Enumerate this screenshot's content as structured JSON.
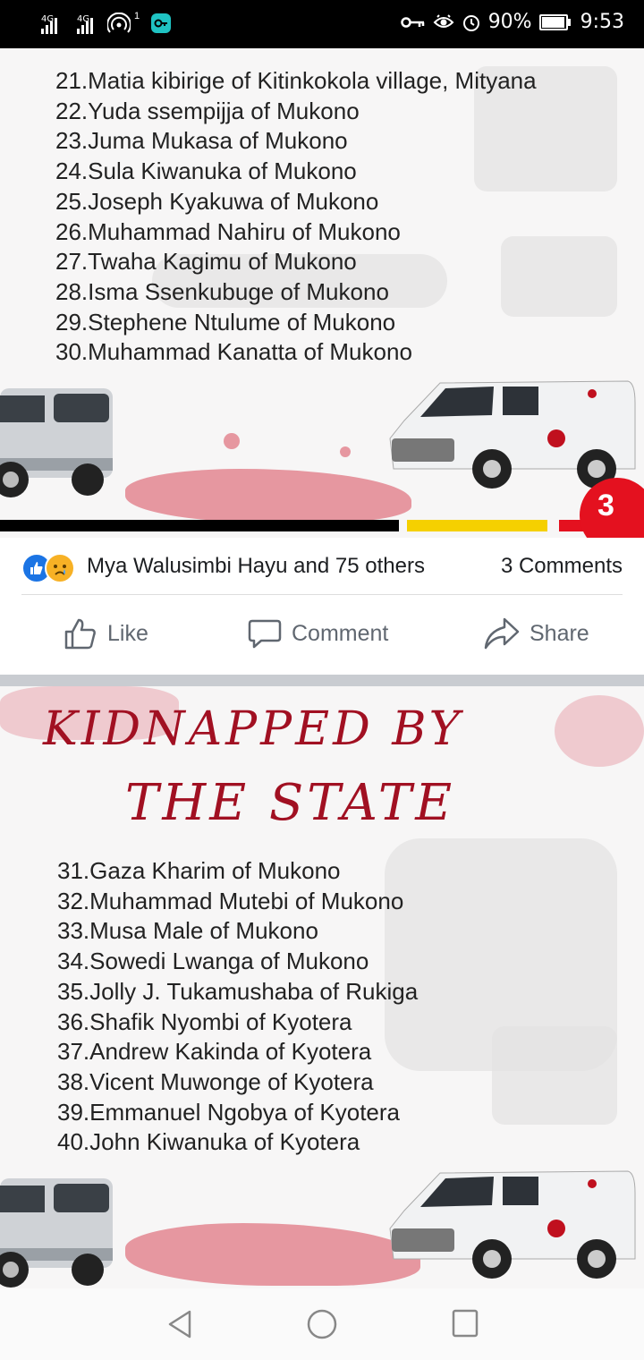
{
  "status_bar": {
    "signal_1": "4G",
    "signal_2": "4G",
    "hotspot_count": "1",
    "battery": "90%",
    "time": "9:53",
    "icons": [
      "signal-icon",
      "signal-icon",
      "hotspot-icon",
      "vpn-key-icon",
      "key-icon",
      "eye-icon",
      "alarm-icon",
      "battery-icon"
    ]
  },
  "post1": {
    "names": [
      "21.Matia kibirige of Kitinkokola  village, Mityana",
      "22.Yuda ssempijja of Mukono",
      "23.Juma Mukasa of Mukono",
      "24.Sula Kiwanuka of Mukono",
      "25.Joseph Kyakuwa of Mukono",
      "26.Muhammad Nahiru of Mukono",
      "27.Twaha Kagimu of Mukono",
      "28.Isma Ssenkubuge of Mukono",
      "29.Stephene Ntulume of Mukono",
      "30.Muhammad Kanatta of Mukono"
    ],
    "page_badge": "3",
    "stripe_colors": [
      "#000000",
      "#f5d000",
      "#e4111f"
    ]
  },
  "reactions": {
    "reactors": "Mya Walusimbi Hayu and 75 others",
    "comments": "3 Comments",
    "icons": [
      "like-reaction-icon",
      "sad-reaction-icon"
    ]
  },
  "actions": {
    "like": "Like",
    "comment": "Comment",
    "share": "Share"
  },
  "post2": {
    "headline_line1": "KIDNAPPED BY",
    "headline_line2": "THE STATE",
    "names": [
      "31.Gaza Kharim of Mukono",
      "32.Muhammad Mutebi of Mukono",
      "33.Musa Male of Mukono",
      "34.Sowedi Lwanga of Mukono",
      "35.Jolly J. Tukamushaba of Rukiga",
      "36.Shafik Nyombi of Kyotera",
      "37.Andrew Kakinda of Kyotera",
      "38.Vicent Muwonge of Kyotera",
      "39.Emmanuel Ngobya of Kyotera",
      "40.John Kiwanuka of Kyotera"
    ]
  },
  "nav_bar": {
    "icons": [
      "back-icon",
      "home-icon",
      "recents-icon"
    ]
  },
  "colors": {
    "facebook_blue": "#1b74e4",
    "headline_red": "#a11022",
    "badge_red": "#e4111f"
  }
}
